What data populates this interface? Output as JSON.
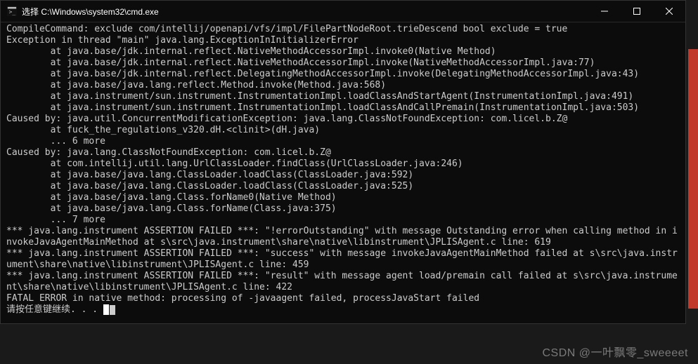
{
  "titlebar": {
    "icon_name": "cmd-icon",
    "title": "选择 C:\\Windows\\system32\\cmd.exe"
  },
  "terminal": {
    "lines": [
      "CompileCommand: exclude com/intellij/openapi/vfs/impl/FilePartNodeRoot.trieDescend bool exclude = true",
      "Exception in thread \"main\" java.lang.ExceptionInInitializerError",
      "        at java.base/jdk.internal.reflect.NativeMethodAccessorImpl.invoke0(Native Method)",
      "        at java.base/jdk.internal.reflect.NativeMethodAccessorImpl.invoke(NativeMethodAccessorImpl.java:77)",
      "        at java.base/jdk.internal.reflect.DelegatingMethodAccessorImpl.invoke(DelegatingMethodAccessorImpl.java:43)",
      "        at java.base/java.lang.reflect.Method.invoke(Method.java:568)",
      "        at java.instrument/sun.instrument.InstrumentationImpl.loadClassAndStartAgent(InstrumentationImpl.java:491)",
      "        at java.instrument/sun.instrument.InstrumentationImpl.loadClassAndCallPremain(InstrumentationImpl.java:503)",
      "Caused by: java.util.ConcurrentModificationException: java.lang.ClassNotFoundException: com.licel.b.Z@",
      "        at fuck_the_regulations_v320.dH.<clinit>(dH.java)",
      "        ... 6 more",
      "Caused by: java.lang.ClassNotFoundException: com.licel.b.Z@",
      "        at com.intellij.util.lang.UrlClassLoader.findClass(UrlClassLoader.java:246)",
      "        at java.base/java.lang.ClassLoader.loadClass(ClassLoader.java:592)",
      "        at java.base/java.lang.ClassLoader.loadClass(ClassLoader.java:525)",
      "        at java.base/java.lang.Class.forName0(Native Method)",
      "        at java.base/java.lang.Class.forName(Class.java:375)",
      "        ... 7 more",
      "*** java.lang.instrument ASSERTION FAILED ***: \"!errorOutstanding\" with message Outstanding error when calling method in invokeJavaAgentMainMethod at s\\src\\java.instrument\\share\\native\\libinstrument\\JPLISAgent.c line: 619",
      "*** java.lang.instrument ASSERTION FAILED ***: \"success\" with message invokeJavaAgentMainMethod failed at s\\src\\java.instrument\\share\\native\\libinstrument\\JPLISAgent.c line: 459",
      "*** java.lang.instrument ASSERTION FAILED ***: \"result\" with message agent load/premain call failed at s\\src\\java.instrument\\share\\native\\libinstrument\\JPLISAgent.c line: 422",
      "FATAL ERROR in native method: processing of -javaagent failed, processJavaStart failed"
    ],
    "prompt": "请按任意键继续. . . "
  },
  "watermark": "CSDN @一叶飘零_sweeeet"
}
